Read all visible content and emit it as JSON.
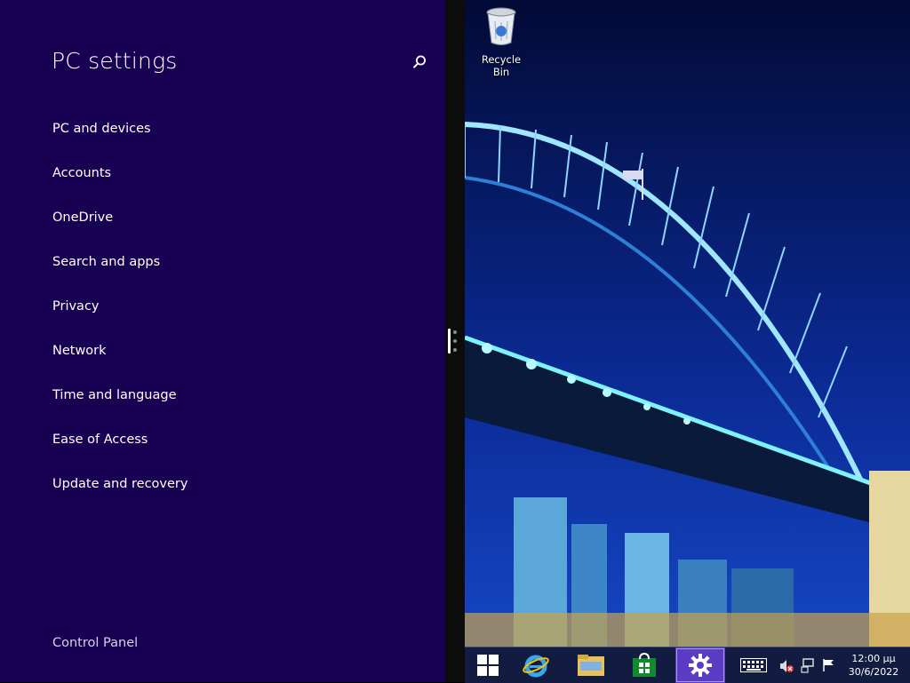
{
  "settings": {
    "title": "PC settings",
    "nav": [
      {
        "label": "PC and devices"
      },
      {
        "label": "Accounts"
      },
      {
        "label": "OneDrive"
      },
      {
        "label": "Search and apps"
      },
      {
        "label": "Privacy"
      },
      {
        "label": "Network"
      },
      {
        "label": "Time and language"
      },
      {
        "label": "Ease of Access"
      },
      {
        "label": "Update and recovery"
      }
    ],
    "control_panel": "Control Panel",
    "search_icon": "search-icon"
  },
  "desktop": {
    "recycle_bin": "Recycle Bin",
    "wallpaper": "sydney-harbour-bridge-night"
  },
  "taskbar": {
    "items": [
      "windows-start-icon",
      "internet-explorer-icon",
      "file-explorer-icon",
      "store-icon",
      "settings-icon"
    ],
    "active": "settings-icon",
    "tray": [
      "touch-keyboard-icon",
      "volume-muted-icon",
      "network-icon",
      "action-center-flag-icon"
    ],
    "time": "12:00 μμ",
    "date": "30/6/2022"
  },
  "colors": {
    "settings_bg": "#180052",
    "taskbar_active": "#5b3cc4"
  }
}
